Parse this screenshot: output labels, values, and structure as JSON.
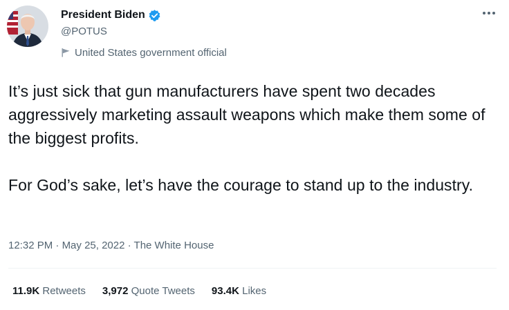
{
  "author": {
    "display_name": "President Biden",
    "handle": "@POTUS",
    "verified": true,
    "label": "United States government official"
  },
  "tweet": {
    "paragraphs": [
      "It’s just sick that gun manufacturers have spent two decades aggressively marketing assault weapons which make them some of the biggest profits.",
      "For God’s sake, let’s have the courage to stand up to the industry."
    ],
    "time": "12:32 PM",
    "date": "May 25, 2022",
    "source": "The White House",
    "separator": "·"
  },
  "stats": {
    "retweets": {
      "count": "11.9K",
      "label": "Retweets"
    },
    "quote_tweets": {
      "count": "3,972",
      "label": "Quote Tweets"
    },
    "likes": {
      "count": "93.4K",
      "label": "Likes"
    }
  },
  "icons": {
    "verified": "verified-badge-icon",
    "government": "flag-icon",
    "more": "more-options-icon"
  },
  "colors": {
    "text_primary": "#0f1419",
    "text_secondary": "#536471",
    "verified_blue": "#1d9bf0",
    "divider": "#eff3f4"
  }
}
